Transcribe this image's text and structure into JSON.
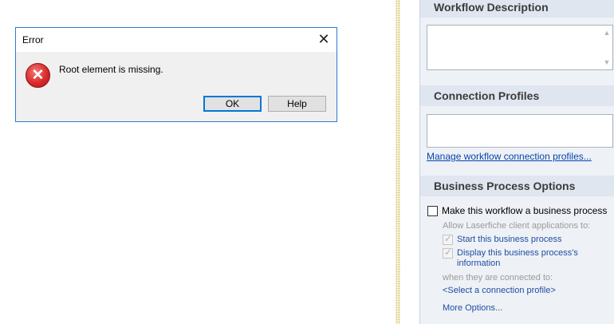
{
  "dialog": {
    "title": "Error",
    "close_icon": "close-icon",
    "message": "Root element is missing.",
    "icon": "error-icon",
    "ok_label": "OK",
    "help_label": "Help"
  },
  "panel": {
    "workflow_description": {
      "header": "Workflow Description",
      "value": ""
    },
    "connection_profiles": {
      "header": "Connection Profiles",
      "value": "",
      "manage_link": "Manage workflow connection profiles..."
    },
    "business_process_options": {
      "header": "Business Process Options",
      "make_business_process": {
        "label": "Make this workflow a business process",
        "checked": false
      },
      "allow_label": "Allow Laserfiche client applications to:",
      "start_process": {
        "label": "Start this business process",
        "checked": true
      },
      "display_info": {
        "label_line1": "Display this business process's",
        "label_line2": "information",
        "checked": true
      },
      "connected_label": "when they are connected to:",
      "select_profile": "<Select a connection profile>",
      "more_options": "More Options..."
    }
  },
  "colors": {
    "accent": "#0078d7",
    "panel_bg": "#eef1f6",
    "header_bg": "#dfe6f0",
    "link": "#0645ad"
  }
}
